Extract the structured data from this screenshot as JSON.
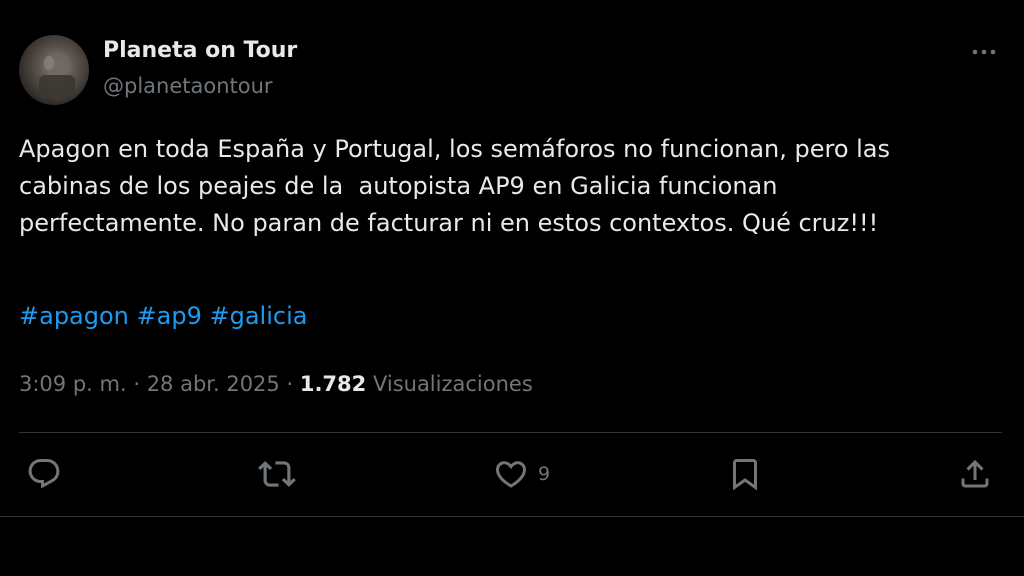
{
  "author": {
    "display_name": "Planeta on Tour",
    "handle": "@planetaontour"
  },
  "tweet": {
    "text_lines": [
      "Apagon en toda España y Portugal, los semáforos no funcionan, pero las",
      "cabinas de los peajes de la  autopista AP9 en Galicia funcionan",
      "perfectamente. No paran de facturar ni en estos contextos. Qué cruz!!!"
    ],
    "hashtags": [
      "#apagon",
      "#ap9",
      "#galicia"
    ]
  },
  "meta": {
    "time": "3:09 p. m.",
    "separator": " · ",
    "date": "28 abr. 2025",
    "views_count": "1.782",
    "views_label": "Visualizaciones"
  },
  "actions": {
    "reply": {
      "icon": "reply-icon"
    },
    "retweet": {
      "icon": "retweet-icon"
    },
    "like": {
      "icon": "heart-icon",
      "count": "9"
    },
    "bookmark": {
      "icon": "bookmark-icon"
    },
    "share": {
      "icon": "share-icon"
    }
  },
  "colors": {
    "background": "#000000",
    "text": "#e7e9ea",
    "secondary_text": "#71767b",
    "link": "#1d9bf0",
    "divider": "#2f3336"
  }
}
